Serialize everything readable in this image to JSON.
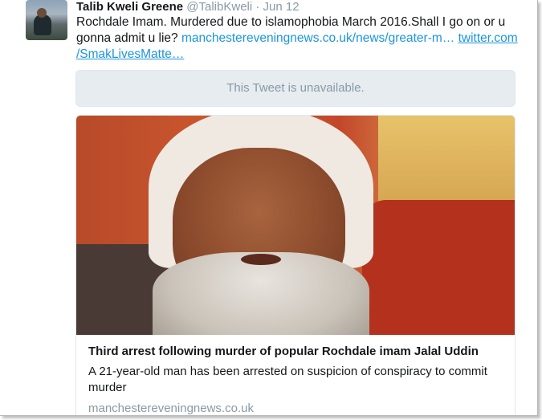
{
  "tweet": {
    "author_name": "Talib Kweli Greene",
    "handle": "@TalibKweli",
    "separator": "·",
    "date": "Jun 12",
    "text_part1": "Rochdale Imam. Murdered due to islamophobia March 2016.Shall I go on or u gonna admit u lie? ",
    "link1": "manchestereveningnews.co.uk/news/greater-m…",
    "link2_a": "twitter.com",
    "link2_b": "/SmakLivesMatte…"
  },
  "quoted": {
    "unavailable_text": "This Tweet is unavailable."
  },
  "card": {
    "title": "Third arrest following murder of popular Rochdale imam Jalal Uddin",
    "description": "A 21-year-old man has been arrested on suspicion of conspiracy to commit murder",
    "domain": "manchestereveningnews.co.uk"
  },
  "colors": {
    "link": "#1b95e0",
    "muted": "#8899a6",
    "text": "#14171a"
  }
}
